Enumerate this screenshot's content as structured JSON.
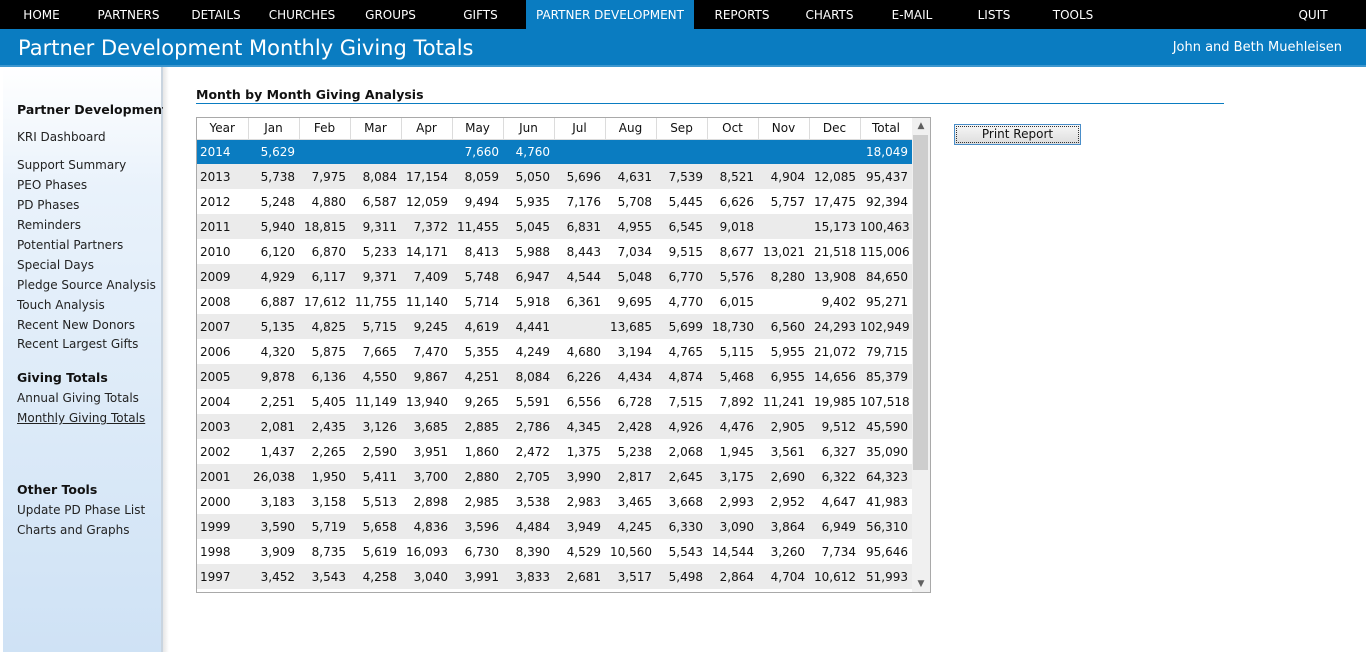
{
  "nav": {
    "items": [
      {
        "label": "HOME"
      },
      {
        "label": "PARTNERS"
      },
      {
        "label": "DETAILS"
      },
      {
        "label": "CHURCHES"
      },
      {
        "label": "GROUPS"
      },
      {
        "label": "GIFTS"
      },
      {
        "label": "PARTNER DEVELOPMENT"
      },
      {
        "label": "REPORTS"
      },
      {
        "label": "CHARTS"
      },
      {
        "label": "E-MAIL"
      },
      {
        "label": "LISTS"
      },
      {
        "label": "TOOLS"
      },
      {
        "label": "QUIT"
      }
    ],
    "active": "PARTNER DEVELOPMENT",
    "active_color": "#0a7cc1"
  },
  "header": {
    "title": "Partner Development Monthly Giving Totals",
    "user": "John and Beth Muehleisen"
  },
  "sidebar": {
    "sections": [
      {
        "heading": "Partner Development",
        "links": [
          "KRI Dashboard",
          "Support Summary",
          "PEO Phases",
          "PD Phases",
          "Reminders",
          "Potential Partners",
          "Special Days",
          "Pledge Source Analysis",
          "Touch Analysis",
          "Recent New Donors",
          "Recent Largest Gifts"
        ]
      },
      {
        "heading": "Giving Totals",
        "links": [
          "Annual Giving Totals",
          "Monthly Giving Totals"
        ]
      },
      {
        "heading": "Other Tools",
        "links": [
          "Update PD Phase List",
          "Charts and Graphs"
        ]
      }
    ],
    "current_link": "Monthly Giving Totals"
  },
  "main": {
    "section_title": "Month by Month Giving Analysis",
    "print_button": "Print Report",
    "selected_year": "2014",
    "table": {
      "columns": [
        "Year",
        "Jan",
        "Feb",
        "Mar",
        "Apr",
        "May",
        "Jun",
        "Jul",
        "Aug",
        "Sep",
        "Oct",
        "Nov",
        "Dec",
        "Total"
      ],
      "rows": [
        [
          "2014",
          "5,629",
          "",
          "",
          "",
          "7,660",
          "4,760",
          "",
          "",
          "",
          "",
          "",
          "",
          "18,049"
        ],
        [
          "2013",
          "5,738",
          "7,975",
          "8,084",
          "17,154",
          "8,059",
          "5,050",
          "5,696",
          "4,631",
          "7,539",
          "8,521",
          "4,904",
          "12,085",
          "95,437"
        ],
        [
          "2012",
          "5,248",
          "4,880",
          "6,587",
          "12,059",
          "9,494",
          "5,935",
          "7,176",
          "5,708",
          "5,445",
          "6,626",
          "5,757",
          "17,475",
          "92,394"
        ],
        [
          "2011",
          "5,940",
          "18,815",
          "9,311",
          "7,372",
          "11,455",
          "5,045",
          "6,831",
          "4,955",
          "6,545",
          "9,018",
          "",
          "15,173",
          "100,463"
        ],
        [
          "2010",
          "6,120",
          "6,870",
          "5,233",
          "14,171",
          "8,413",
          "5,988",
          "8,443",
          "7,034",
          "9,515",
          "8,677",
          "13,021",
          "21,518",
          "115,006"
        ],
        [
          "2009",
          "4,929",
          "6,117",
          "9,371",
          "7,409",
          "5,748",
          "6,947",
          "4,544",
          "5,048",
          "6,770",
          "5,576",
          "8,280",
          "13,908",
          "84,650"
        ],
        [
          "2008",
          "6,887",
          "17,612",
          "11,755",
          "11,140",
          "5,714",
          "5,918",
          "6,361",
          "9,695",
          "4,770",
          "6,015",
          "",
          "9,402",
          "95,271"
        ],
        [
          "2007",
          "5,135",
          "4,825",
          "5,715",
          "9,245",
          "4,619",
          "4,441",
          "",
          "13,685",
          "5,699",
          "18,730",
          "6,560",
          "24,293",
          "102,949"
        ],
        [
          "2006",
          "4,320",
          "5,875",
          "7,665",
          "7,470",
          "5,355",
          "4,249",
          "4,680",
          "3,194",
          "4,765",
          "5,115",
          "5,955",
          "21,072",
          "79,715"
        ],
        [
          "2005",
          "9,878",
          "6,136",
          "4,550",
          "9,867",
          "4,251",
          "8,084",
          "6,226",
          "4,434",
          "4,874",
          "5,468",
          "6,955",
          "14,656",
          "85,379"
        ],
        [
          "2004",
          "2,251",
          "5,405",
          "11,149",
          "13,940",
          "9,265",
          "5,591",
          "6,556",
          "6,728",
          "7,515",
          "7,892",
          "11,241",
          "19,985",
          "107,518"
        ],
        [
          "2003",
          "2,081",
          "2,435",
          "3,126",
          "3,685",
          "2,885",
          "2,786",
          "4,345",
          "2,428",
          "4,926",
          "4,476",
          "2,905",
          "9,512",
          "45,590"
        ],
        [
          "2002",
          "1,437",
          "2,265",
          "2,590",
          "3,951",
          "1,860",
          "2,472",
          "1,375",
          "5,238",
          "2,068",
          "1,945",
          "3,561",
          "6,327",
          "35,090"
        ],
        [
          "2001",
          "26,038",
          "1,950",
          "5,411",
          "3,700",
          "2,880",
          "2,705",
          "3,990",
          "2,817",
          "2,645",
          "3,175",
          "2,690",
          "6,322",
          "64,323"
        ],
        [
          "2000",
          "3,183",
          "3,158",
          "5,513",
          "2,898",
          "2,985",
          "3,538",
          "2,983",
          "3,465",
          "3,668",
          "2,993",
          "2,952",
          "4,647",
          "41,983"
        ],
        [
          "1999",
          "3,590",
          "5,719",
          "5,658",
          "4,836",
          "3,596",
          "4,484",
          "3,949",
          "4,245",
          "6,330",
          "3,090",
          "3,864",
          "6,949",
          "56,310"
        ],
        [
          "1998",
          "3,909",
          "8,735",
          "5,619",
          "16,093",
          "6,730",
          "8,390",
          "4,529",
          "10,560",
          "5,543",
          "14,544",
          "3,260",
          "7,734",
          "95,646"
        ],
        [
          "1997",
          "3,452",
          "3,543",
          "4,258",
          "3,040",
          "3,991",
          "3,833",
          "2,681",
          "3,517",
          "5,498",
          "2,864",
          "4,704",
          "10,612",
          "51,993"
        ]
      ]
    }
  },
  "scrollbar": {
    "up_icon": "▲",
    "down_icon": "▼"
  }
}
